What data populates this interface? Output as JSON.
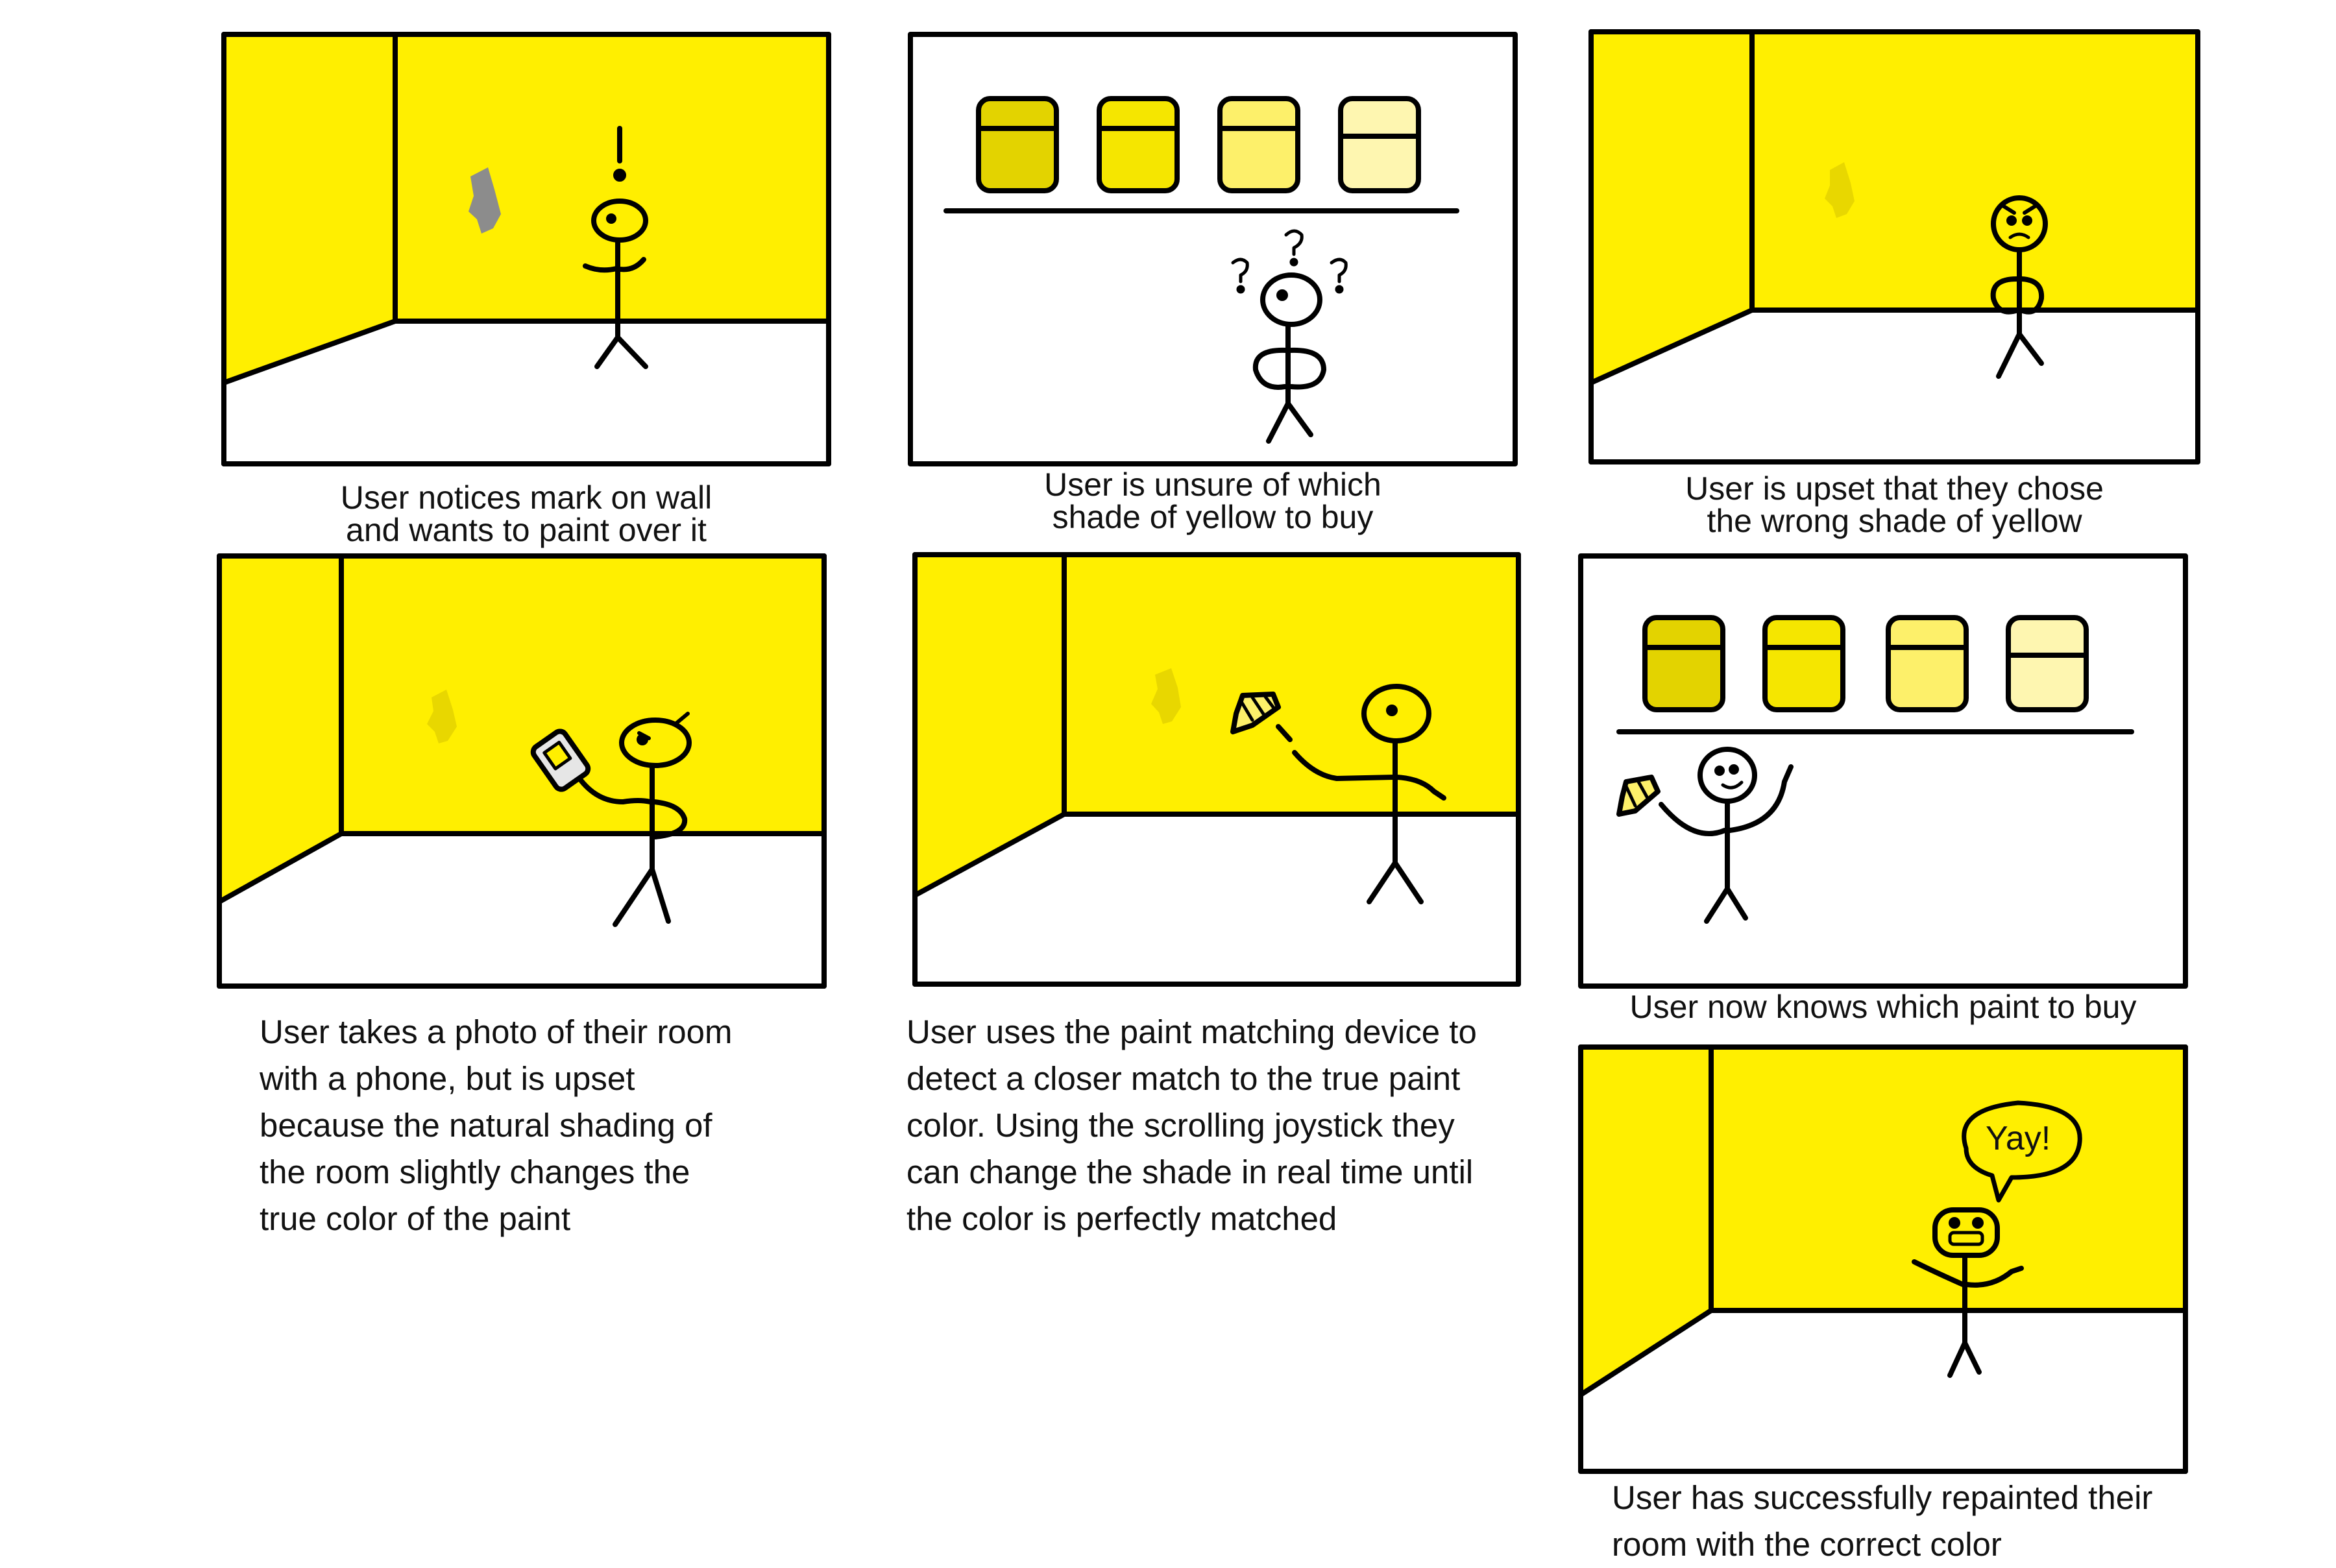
{
  "storyboard": {
    "colors": {
      "wall": "#ffef00",
      "floor": "#ffffff",
      "outline": "#000000",
      "mark": "#8c8c8c",
      "faded_mark": "#e8d700",
      "paint_shades": [
        "#e3d300",
        "#f5e600",
        "#fdf06a",
        "#fef6b0"
      ]
    },
    "panels": [
      {
        "id": 1,
        "scene": "room",
        "caption": [
          "User notices mark on wall",
          "and wants to paint over it"
        ]
      },
      {
        "id": 2,
        "scene": "store-shelf",
        "caption": [
          "User is unsure of which",
          "shade of yellow to buy"
        ]
      },
      {
        "id": 3,
        "scene": "room",
        "caption": [
          "User is upset that they chose",
          "the wrong shade of yellow"
        ]
      },
      {
        "id": 4,
        "scene": "room",
        "caption": [
          "User takes a photo of their room",
          "with a phone, but is upset",
          "because the natural shading of",
          "the room slightly changes the",
          "true color of the paint"
        ]
      },
      {
        "id": 5,
        "scene": "room",
        "caption": [
          "User uses the paint matching device to",
          "detect a closer match to the true paint",
          "color. Using the scrolling joystick they",
          "can change the shade in real time until",
          "the color is perfectly matched"
        ]
      },
      {
        "id": 6,
        "scene": "store-shelf",
        "caption": [
          "User now knows which paint to buy"
        ]
      },
      {
        "id": 7,
        "scene": "room",
        "caption": [
          "User has successfully repainted their",
          "room with the correct color"
        ],
        "speech_bubble": "Yay!"
      }
    ]
  }
}
